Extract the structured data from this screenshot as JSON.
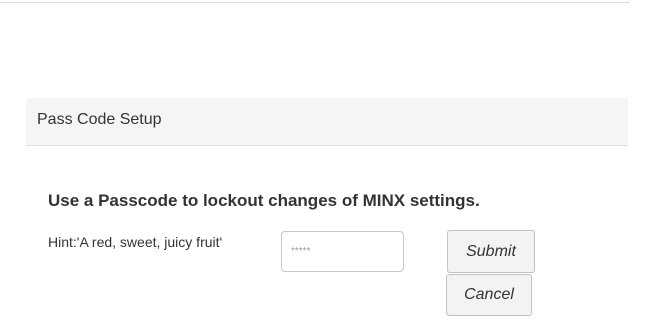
{
  "panel": {
    "title": "Pass Code Setup"
  },
  "form": {
    "heading": "Use a Passcode to lockout changes of MINX settings.",
    "hint": "Hint:'A red, sweet, juicy fruit'",
    "passcode_placeholder": "*****",
    "submit_label": "Submit",
    "cancel_label": "Cancel"
  }
}
